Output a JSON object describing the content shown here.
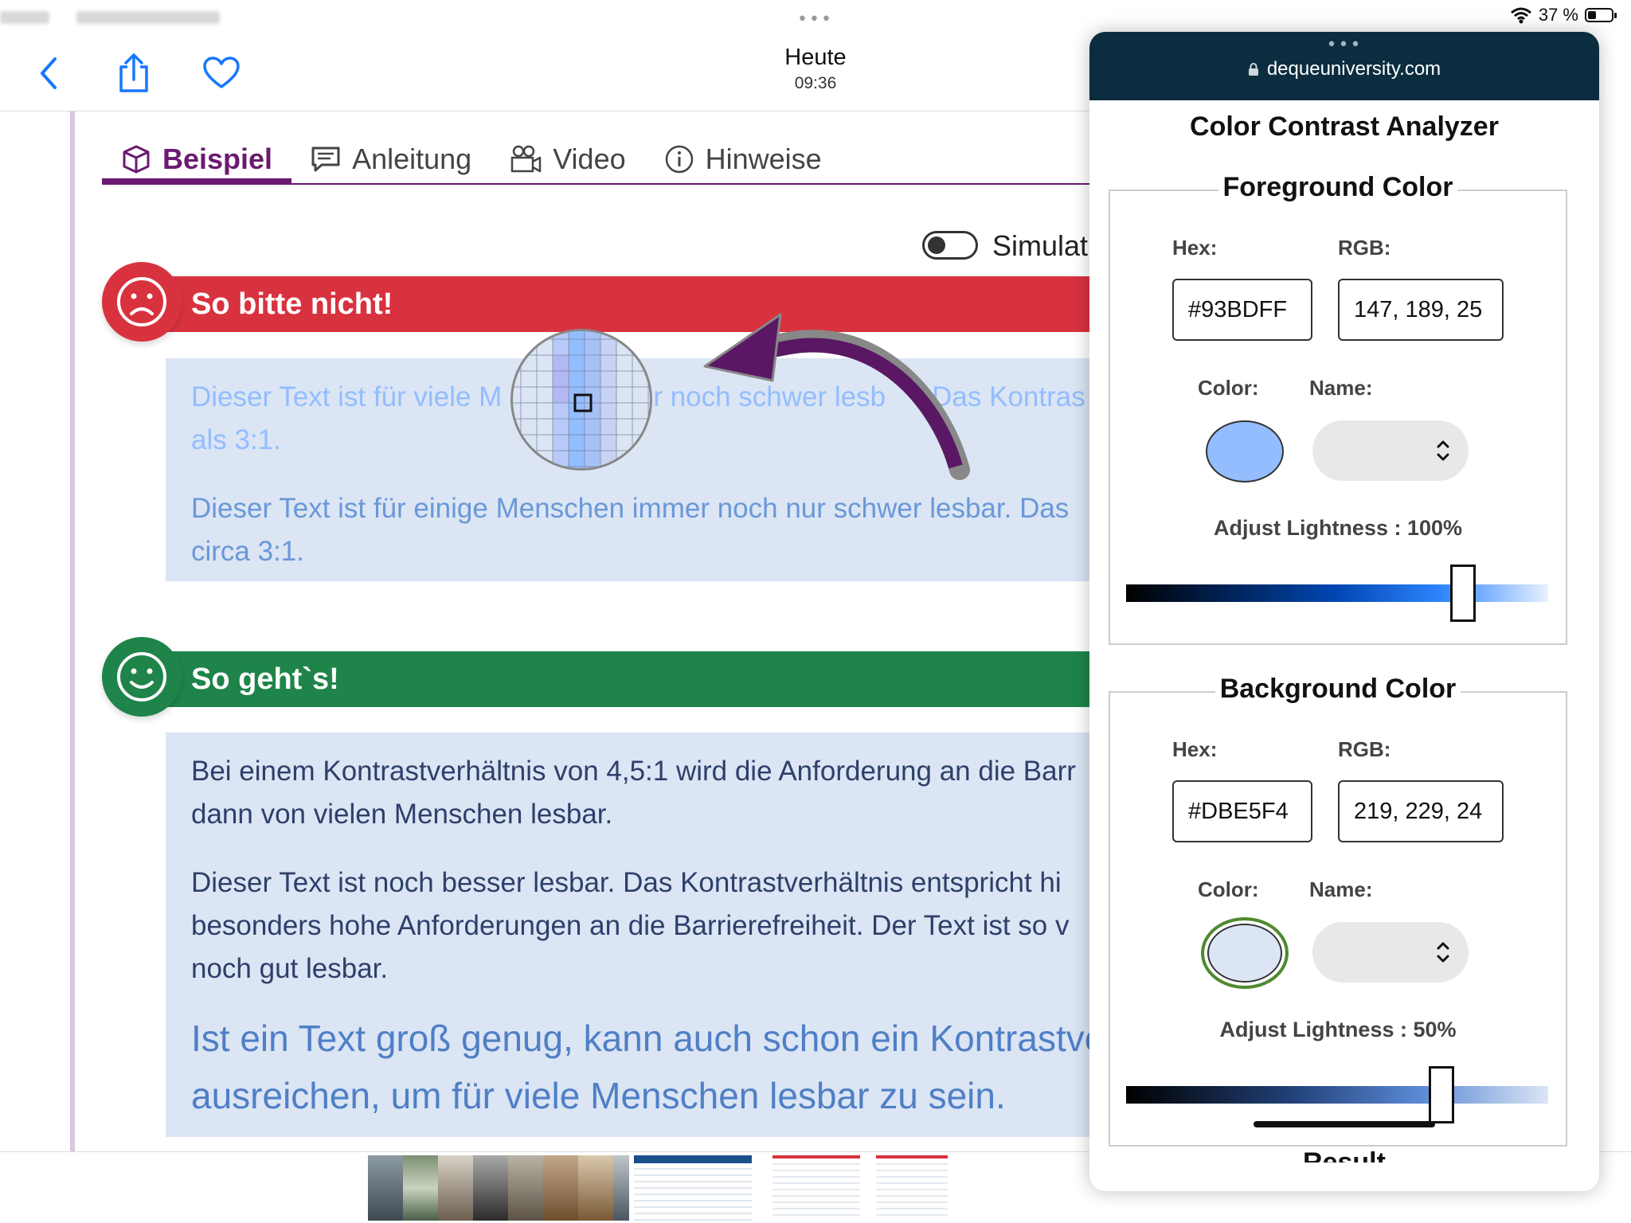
{
  "status_bar": {
    "battery": "37 %",
    "battery_level": 0.37
  },
  "header": {
    "title": "Heute",
    "time": "09:36"
  },
  "tabs": [
    {
      "label": "Beispiel",
      "icon": "cube-icon",
      "active": true
    },
    {
      "label": "Anleitung",
      "icon": "message-icon",
      "active": false
    },
    {
      "label": "Video",
      "icon": "video-camera-icon",
      "active": false
    },
    {
      "label": "Hinweise",
      "icon": "info-icon",
      "active": false
    }
  ],
  "simulation_toggle": {
    "label": "Simulat",
    "on": false
  },
  "bad_example": {
    "heading": "So bitte nicht!",
    "para1_line1": "Dieser Text ist für viele M",
    "para1_line1_end": "r noch schwer lesb",
    "para1_line1_tail": "Das Kontras",
    "para1_line2": "als 3:1.",
    "para2_line1": "Dieser Text ist für einige Menschen immer noch nur schwer lesbar. Das",
    "para2_line2": "circa 3:1."
  },
  "good_example": {
    "heading": "So geht`s!",
    "para1_line1": "Bei einem Kontrastverhältnis von 4,5:1 wird die Anforderung an die Barr",
    "para1_line2": "dann von vielen Menschen lesbar.",
    "para2_line1": "Dieser Text ist noch besser lesbar. Das Kontrastverhältnis entspricht hi",
    "para2_line2": "besonders hohe Anforderungen an die Barrierefreiheit. Der Text ist so v",
    "para2_line3": "noch gut lesbar.",
    "para3_line1": "Ist ein Text groß genug, kann auch schon ein Kontrastve",
    "para3_line2": "ausreichen, um für viele Menschen lesbar zu sein."
  },
  "colors": {
    "bad_banner": "#d9323f",
    "good_banner": "#1e8449",
    "accent_purple": "#6a1a70",
    "text_box_bg": "#dbe5f4",
    "low_contrast_text": "#93bdff",
    "panel_header": "#0c2d3f"
  },
  "analyzer": {
    "url": "dequeuniversity.com",
    "title": "Color Contrast Analyzer",
    "foreground": {
      "legend": "Foreground Color",
      "hex_label": "Hex:",
      "rgb_label": "RGB:",
      "hex_value": "#93BDFF",
      "rgb_value": "147, 189, 25",
      "color_label": "Color:",
      "name_label": "Name:",
      "swatch_color": "#93bdff",
      "lightness_label": "Adjust Lightness : 100%",
      "lightness_value": 1.0
    },
    "background": {
      "legend": "Background Color",
      "hex_label": "Hex:",
      "rgb_label": "RGB:",
      "hex_value": "#DBE5F4",
      "rgb_value": "219, 229, 24",
      "color_label": "Color:",
      "name_label": "Name:",
      "swatch_color": "#dbe5f4",
      "lightness_label": "Adjust Lightness : 50%",
      "lightness_value": 0.5
    },
    "result_heading": "Result"
  }
}
